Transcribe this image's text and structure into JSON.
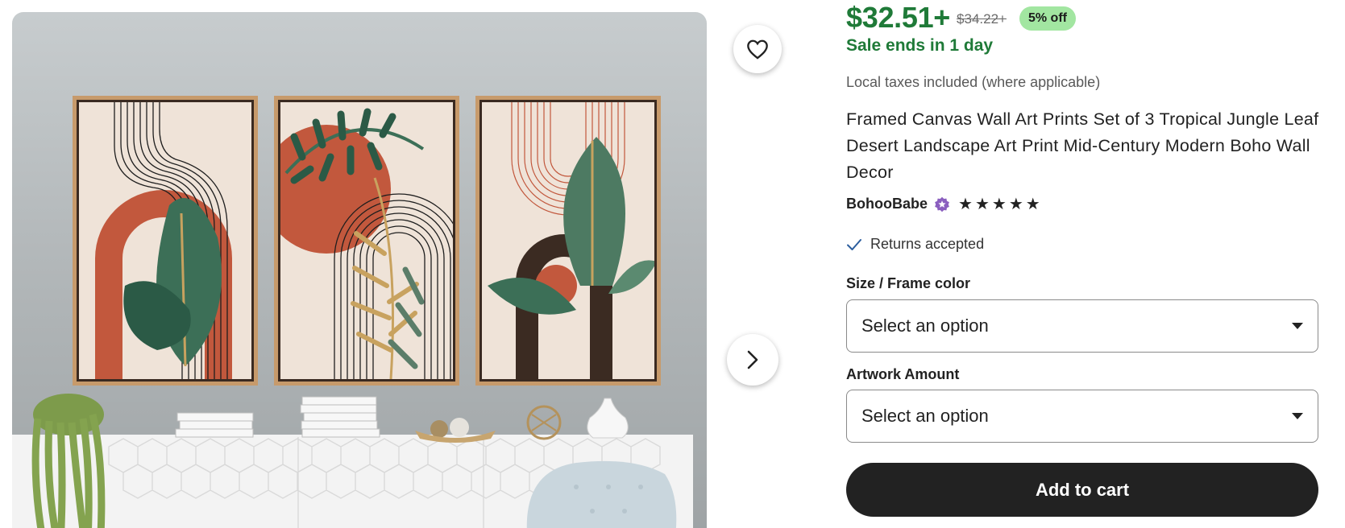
{
  "product_image": {
    "alt_icon": "product-photo",
    "frames": 3
  },
  "actions": {
    "favorite_icon": "heart-icon",
    "next_image_icon": "chevron-right-icon"
  },
  "pricing": {
    "price": "$32.51+",
    "original_price": "$34.22+",
    "discount": "5% off",
    "sale_ends": "Sale ends in 1 day",
    "taxes_note": "Local taxes included (where applicable)",
    "sale_color": "#1f7a38",
    "badge_color": "#a2e6a1"
  },
  "listing": {
    "title": "Framed Canvas Wall Art Prints Set of 3 Tropical Jungle Leaf Desert Landscape Art Print Mid-Century Modern Boho Wall Decor"
  },
  "shop": {
    "name": "BohooBabe",
    "badge_icon": "star-seller-icon",
    "rating": 5,
    "star_glyph": "★"
  },
  "policies": {
    "returns": "Returns accepted",
    "returns_icon": "check-icon"
  },
  "variations": {
    "size_frame": {
      "label": "Size / Frame color",
      "value": "Select an option"
    },
    "artwork_amount": {
      "label": "Artwork Amount",
      "value": "Select an option"
    }
  },
  "cart": {
    "add_to_cart_label": "Add to cart"
  }
}
